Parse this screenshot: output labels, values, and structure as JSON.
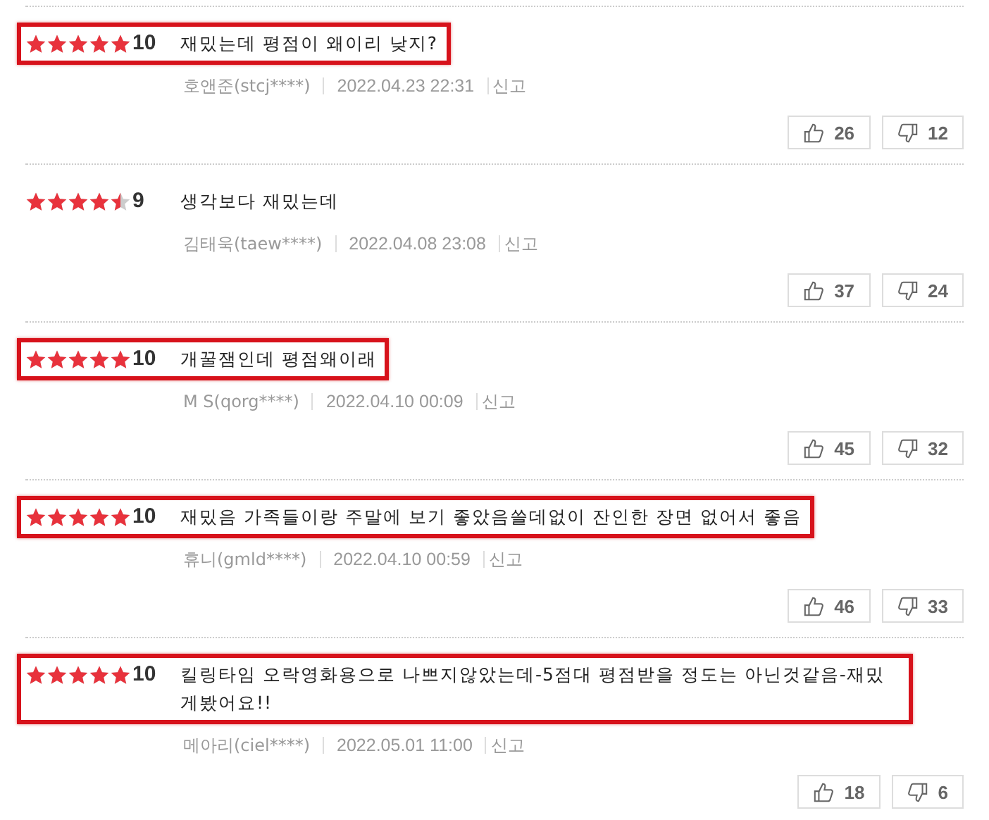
{
  "reviews": [
    {
      "stars": 5,
      "score": "10",
      "text": "재밌는데 평점이 왜이리 낮지?",
      "highlighted": true,
      "author": "호앤준(stcj****)",
      "date": "2022.04.23 22:31",
      "report": "신고",
      "likes": "26",
      "dislikes": "12"
    },
    {
      "stars": 4.5,
      "score": "9",
      "text": "생각보다 재밌는데",
      "highlighted": false,
      "author": "김태욱(taew****)",
      "date": "2022.04.08 23:08",
      "report": "신고",
      "likes": "37",
      "dislikes": "24"
    },
    {
      "stars": 5,
      "score": "10",
      "text": "개꿀잼인데 평점왜이래",
      "highlighted": true,
      "author": "M S(qorg****)",
      "date": "2022.04.10 00:09",
      "report": "신고",
      "likes": "45",
      "dislikes": "32"
    },
    {
      "stars": 5,
      "score": "10",
      "text": "재밌음 가족들이랑 주말에 보기 좋았음쓸데없이 잔인한 장면 없어서 좋음",
      "highlighted": true,
      "author": "휴니(gmld****)",
      "date": "2022.04.10 00:59",
      "report": "신고",
      "likes": "46",
      "dislikes": "33"
    },
    {
      "stars": 5,
      "score": "10",
      "text": "킬링타임 오락영화용으로 나쁘지않았는데-5점대 평점받을 정도는 아닌것같음-재밌게봤어요!!",
      "highlighted": true,
      "author": "메아리(ciel****)",
      "date": "2022.05.01 11:00",
      "report": "신고",
      "likes": "18",
      "dislikes": "6"
    }
  ]
}
